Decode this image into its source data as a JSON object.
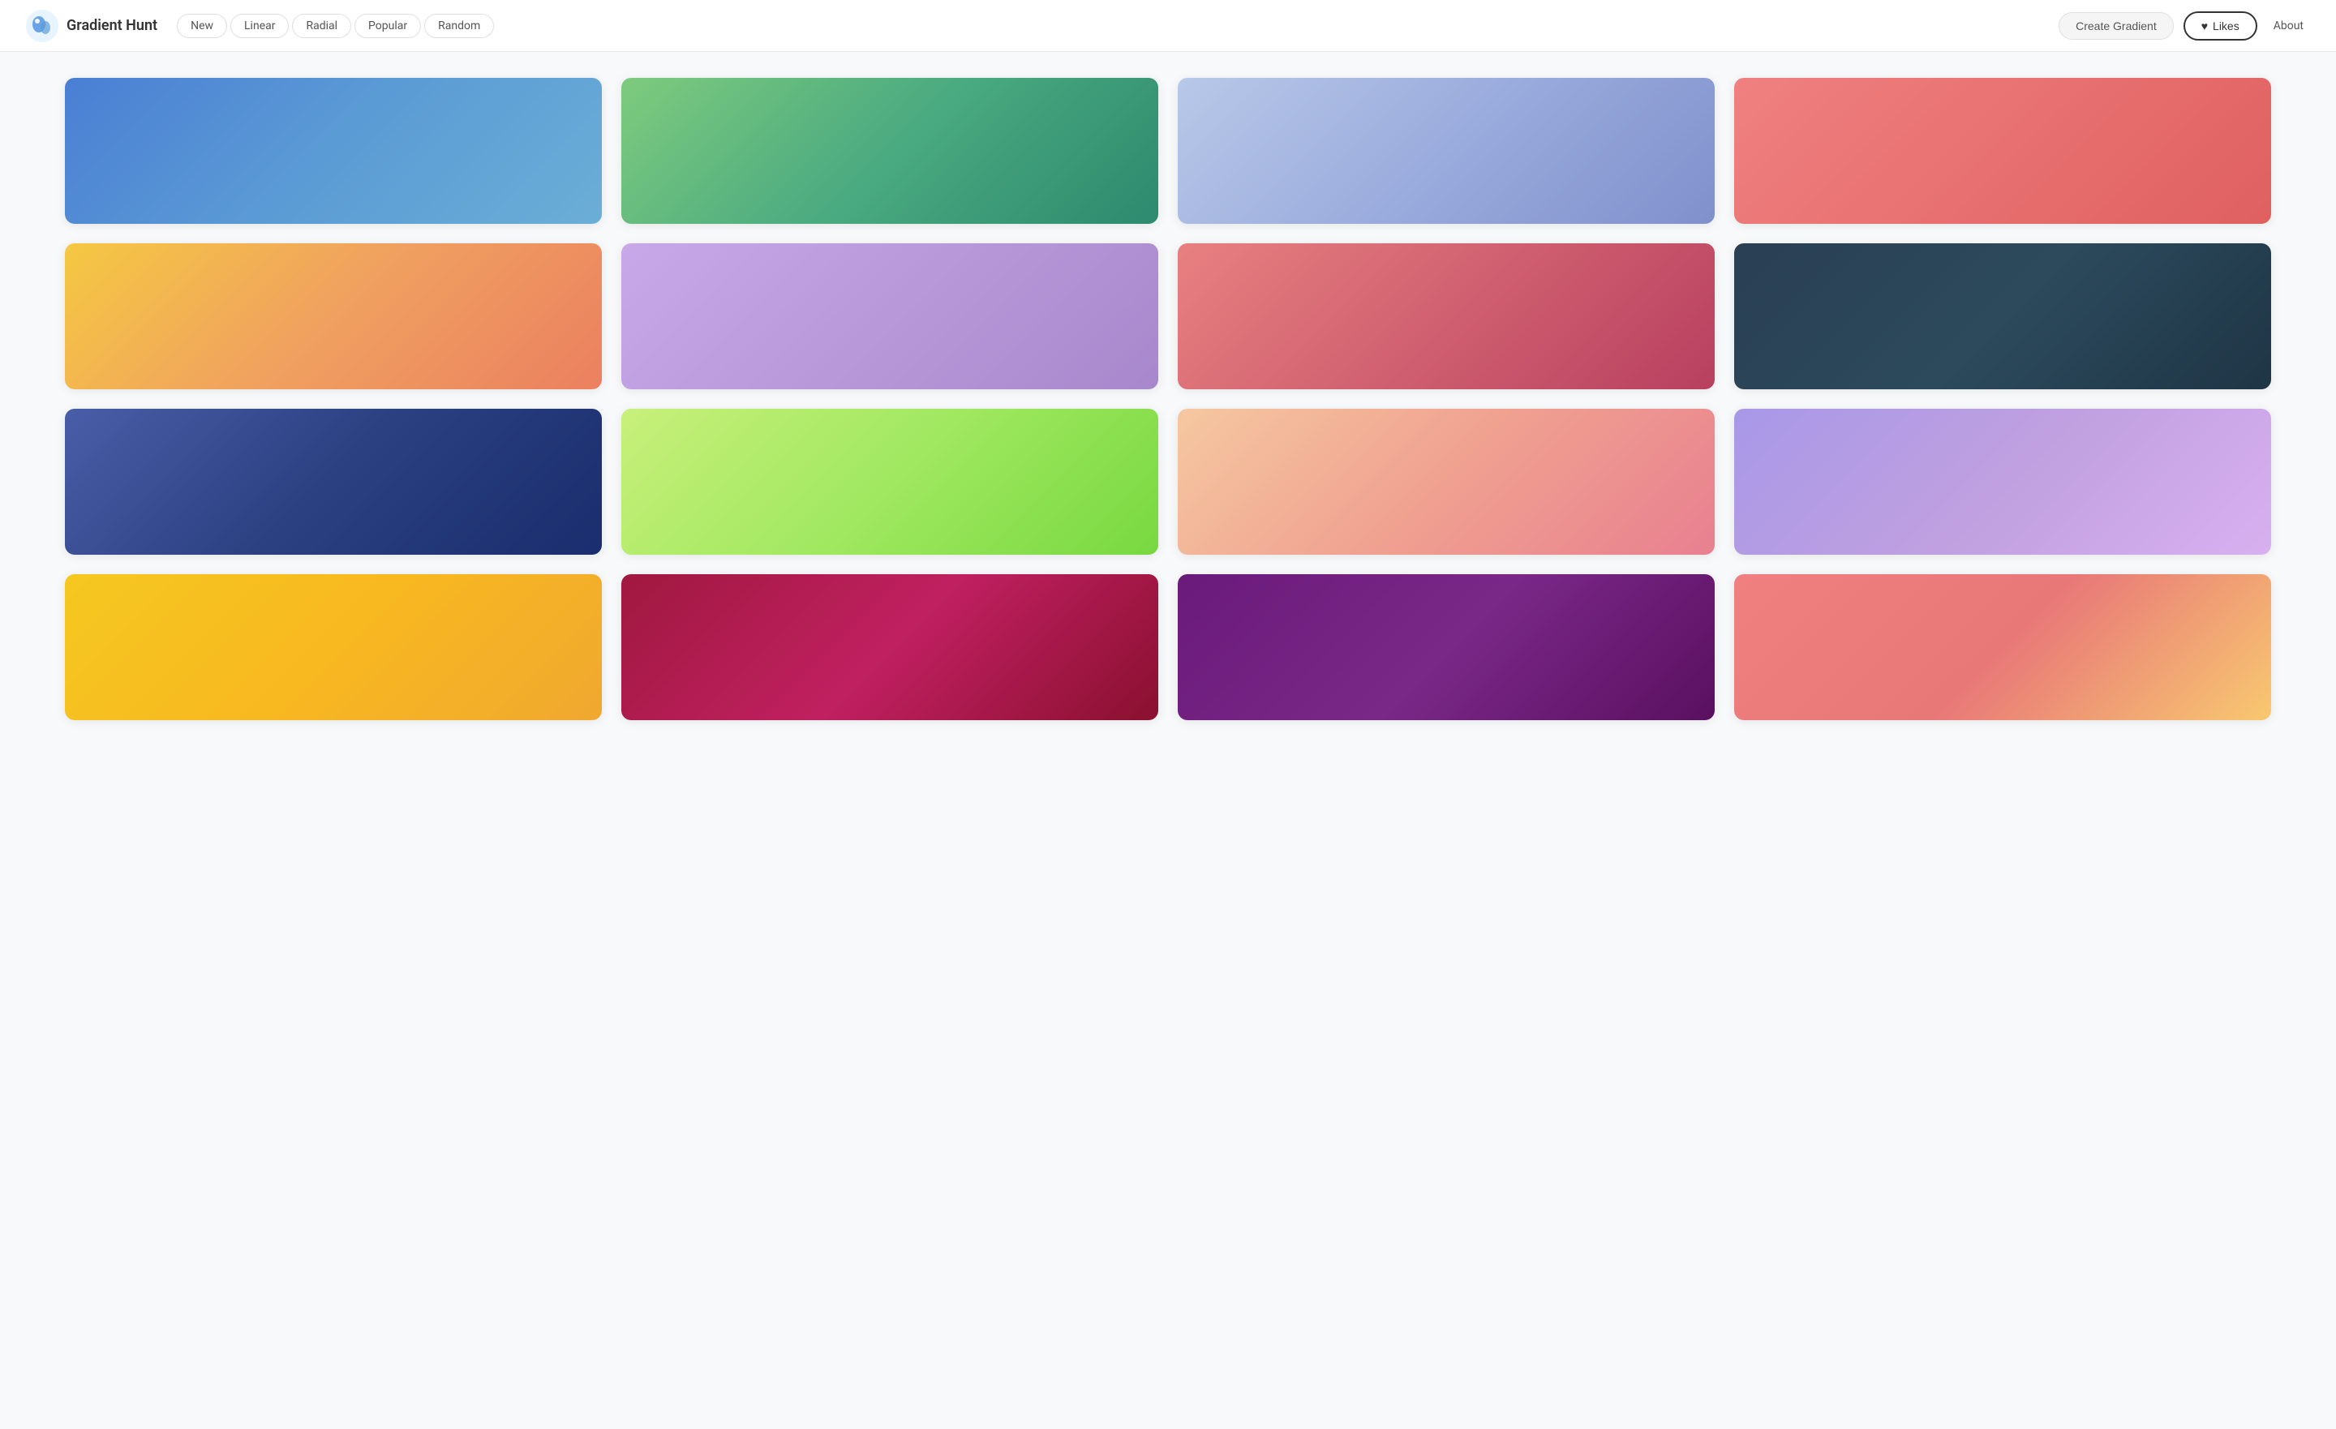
{
  "header": {
    "logo_text": "Gradient Hunt",
    "nav": [
      {
        "label": "New",
        "id": "new"
      },
      {
        "label": "Linear",
        "id": "linear"
      },
      {
        "label": "Radial",
        "id": "radial"
      },
      {
        "label": "Popular",
        "id": "popular"
      },
      {
        "label": "Random",
        "id": "random"
      }
    ],
    "create_btn_label": "Create Gradient",
    "likes_btn_label": "Likes",
    "about_label": "About",
    "heart_icon": "♥"
  },
  "gradients": [
    {
      "id": "g1",
      "gradient": "linear-gradient(135deg, #4a7fd4 0%, #5b9bd5 50%, #6baed6 100%)"
    },
    {
      "id": "g2",
      "gradient": "linear-gradient(135deg, #7ecb7e 0%, #4aaa80 50%, #2d8a6e 100%)"
    },
    {
      "id": "g3",
      "gradient": "linear-gradient(135deg, #b8c8e8 0%, #9aabdd 50%, #8090cc 100%)"
    },
    {
      "id": "g4",
      "gradient": "linear-gradient(135deg, #f08080 0%, #e87070 50%, #e06060 100%)"
    },
    {
      "id": "g5",
      "gradient": "linear-gradient(135deg, #f5c842 0%, #f0a060 50%, #eb8060 100%)"
    },
    {
      "id": "g6",
      "gradient": "linear-gradient(135deg, #c8a8e8 0%, #b898d8 50%, #a888cc 100%)"
    },
    {
      "id": "g7",
      "gradient": "linear-gradient(135deg, #e88080 0%, #d06070 50%, #b84060 100%)"
    },
    {
      "id": "g8",
      "gradient": "linear-gradient(135deg, #2a3f54 0%, #2c4a5c 50%, #1e3545 100%)"
    },
    {
      "id": "g9",
      "gradient": "linear-gradient(135deg, #4a5da8 0%, #2a4080 50%, #1a2d6e 100%)"
    },
    {
      "id": "g10",
      "gradient": "linear-gradient(135deg, #c8f07a 0%, #a0e860 50%, #78d840 100%)"
    },
    {
      "id": "g11",
      "gradient": "linear-gradient(135deg, #f5c8a0 0%, #f0a090 50%, #e88090 100%)"
    },
    {
      "id": "g12",
      "gradient": "linear-gradient(135deg, #a898e8 0%, #c0a0e0 50%, #d8b0f0 100%)"
    },
    {
      "id": "g13",
      "gradient": "linear-gradient(135deg, #f5c820 0%, #f8b820 50%, #f0a830 100%)"
    },
    {
      "id": "g14",
      "gradient": "linear-gradient(135deg, #a01840 0%, #c02060 50%, #8a1030 100%)"
    },
    {
      "id": "g15",
      "gradient": "linear-gradient(135deg, #6a1a7a 0%, #7a2888 50%, #5a1060 100%)"
    },
    {
      "id": "g16",
      "gradient": "linear-gradient(135deg, #f08080 0%, #e87878 50%, #f8c870 100%)"
    }
  ]
}
